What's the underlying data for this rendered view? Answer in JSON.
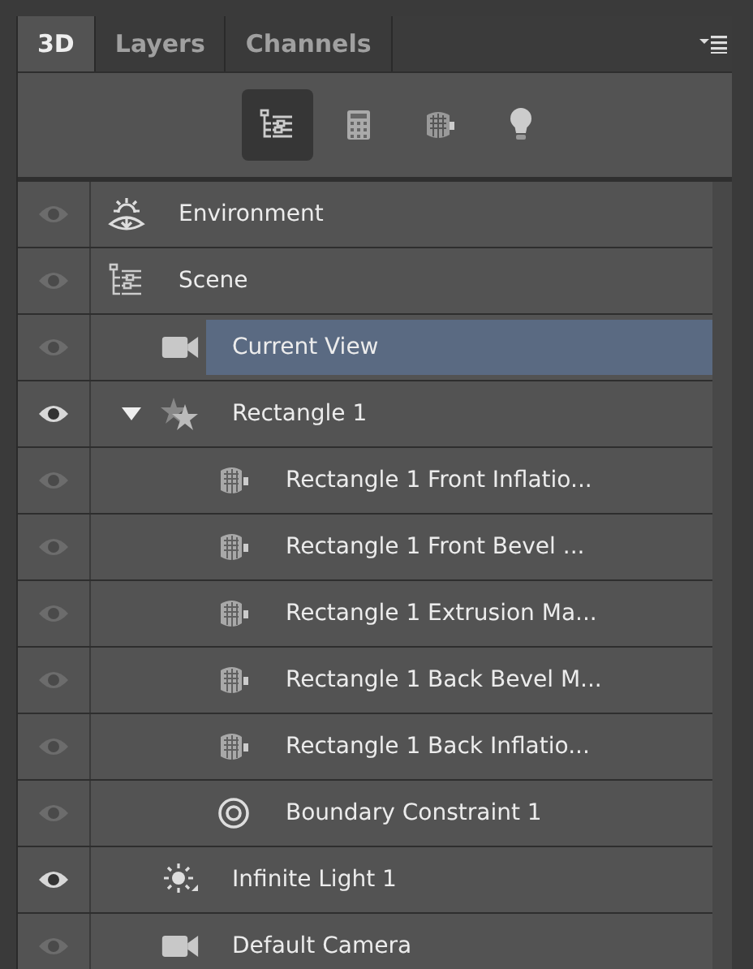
{
  "tabs": [
    {
      "label": "3D",
      "selected": true
    },
    {
      "label": "Layers",
      "selected": false
    },
    {
      "label": "Channels",
      "selected": false
    }
  ],
  "filters": [
    {
      "kind": "scene",
      "selected": true
    },
    {
      "kind": "mesh-list",
      "selected": false
    },
    {
      "kind": "material",
      "selected": false
    },
    {
      "kind": "light",
      "selected": false
    }
  ],
  "tree": [
    {
      "name": "Environment",
      "kind": "environment",
      "visible": false,
      "selected": false
    },
    {
      "name": "Scene",
      "kind": "scene",
      "visible": false,
      "selected": false,
      "children": [
        {
          "name": "Current View",
          "kind": "camera",
          "visible": false,
          "selected": true
        },
        {
          "name": "Rectangle 1",
          "kind": "group",
          "visible": true,
          "selected": false,
          "expanded": true,
          "children": [
            {
              "name": "Rectangle 1 Front Inflatio...",
              "kind": "material",
              "visible": false,
              "selected": false
            },
            {
              "name": "Rectangle 1 Front Bevel ...",
              "kind": "material",
              "visible": false,
              "selected": false
            },
            {
              "name": "Rectangle 1 Extrusion Ma...",
              "kind": "material",
              "visible": false,
              "selected": false
            },
            {
              "name": "Rectangle 1 Back Bevel M...",
              "kind": "material",
              "visible": false,
              "selected": false
            },
            {
              "name": "Rectangle 1 Back Inflatio...",
              "kind": "material",
              "visible": false,
              "selected": false
            },
            {
              "name": "Boundary Constraint 1",
              "kind": "constraint",
              "visible": false,
              "selected": false
            }
          ]
        },
        {
          "name": "Infinite Light 1",
          "kind": "light",
          "visible": true,
          "selected": false
        },
        {
          "name": "Default Camera",
          "kind": "camera",
          "visible": false,
          "selected": false
        }
      ]
    }
  ]
}
